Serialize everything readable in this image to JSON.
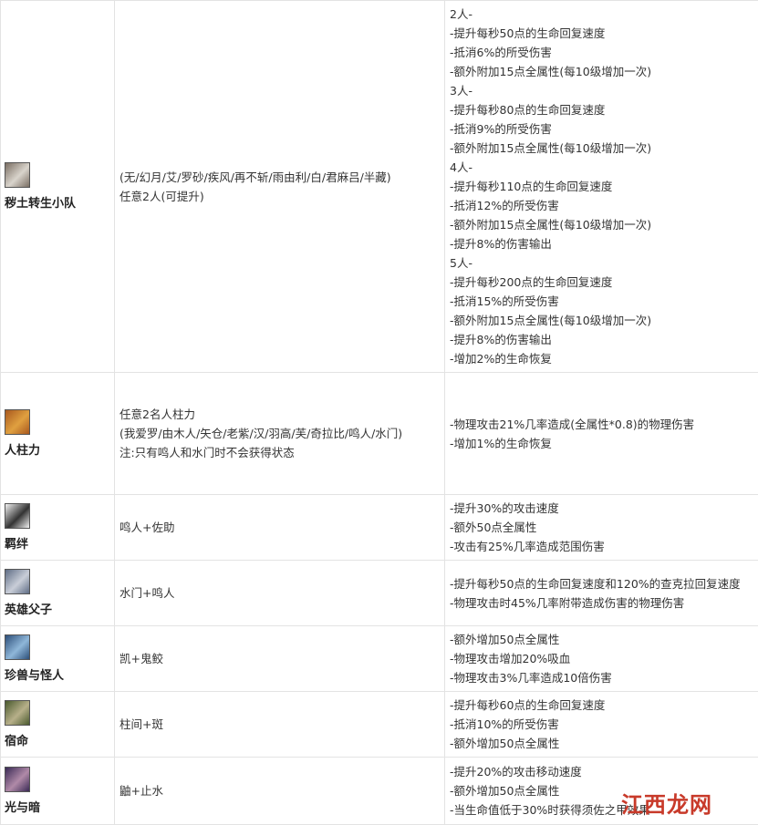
{
  "rows": [
    {
      "name": "秽土转生小队",
      "icon": "edo-tensei-team-icon",
      "icon_colors": [
        "#7a6e63",
        "#d9d4cc"
      ],
      "members": [
        "(无/幻月/艾/罗砂/疾风/再不斩/雨由利/白/君麻吕/半藏)",
        "任意2人(可提升)"
      ],
      "effects": [
        "2人-",
        "-提升每秒50点的生命回复速度",
        "-抵消6%的所受伤害",
        "-额外附加15点全属性(每10级增加一次)",
        "3人-",
        "-提升每秒80点的生命回复速度",
        "-抵消9%的所受伤害",
        "-额外附加15点全属性(每10级增加一次)",
        "4人-",
        "-提升每秒110点的生命回复速度",
        "-抵消12%的所受伤害",
        "-额外附加15点全属性(每10级增加一次)",
        "-提升8%的伤害输出",
        "5人-",
        "-提升每秒200点的生命回复速度",
        "-抵消15%的所受伤害",
        "-额外附加15点全属性(每10级增加一次)",
        "-提升8%的伤害输出",
        "-增加2%的生命恢复"
      ]
    },
    {
      "name": "人柱力",
      "icon": "jinchuriki-icon",
      "icon_colors": [
        "#a8581e",
        "#e0a040"
      ],
      "members": [
        "任意2名人柱力",
        "(我爱罗/由木人/矢仓/老紫/汉/羽高/芙/奇拉比/鸣人/水门)",
        "注:只有鸣人和水门时不会获得状态"
      ],
      "effects": [
        "-物理攻击21%几率造成(全属性*0.8)的物理伤害",
        "-增加1%的生命恢复"
      ]
    },
    {
      "name": "羁绊",
      "icon": "bond-icon",
      "icon_colors": [
        "#f2f2f2",
        "#333333"
      ],
      "members": [
        "鸣人+佐助"
      ],
      "effects": [
        "-提升30%的攻击速度",
        "-额外50点全属性",
        "-攻击有25%几率造成范围伤害"
      ]
    },
    {
      "name": "英雄父子",
      "icon": "hero-father-son-icon",
      "icon_colors": [
        "#5f6d85",
        "#c9ced8"
      ],
      "members": [
        "水门+鸣人"
      ],
      "effects": [
        "-提升每秒50点的生命回复速度和120%的查克拉回复速度",
        "-物理攻击时45%几率附带造成伤害的物理伤害"
      ]
    },
    {
      "name": "珍兽与怪人",
      "icon": "beast-and-freak-icon",
      "icon_colors": [
        "#2d4f7a",
        "#8fb7d9"
      ],
      "members": [
        "凯+鬼鲛"
      ],
      "effects": [
        "-额外增加50点全属性",
        "-物理攻击增加20%吸血",
        "-物理攻击3%几率造成10倍伤害"
      ]
    },
    {
      "name": "宿命",
      "icon": "destiny-icon",
      "icon_colors": [
        "#4a5a2e",
        "#b7b08a"
      ],
      "members": [
        "柱间+斑"
      ],
      "effects": [
        "-提升每秒60点的生命回复速度",
        "-抵消10%的所受伤害",
        "-额外增加50点全属性"
      ]
    },
    {
      "name": "光与暗",
      "icon": "light-and-dark-icon",
      "icon_colors": [
        "#3a2a55",
        "#b08aa8"
      ],
      "members": [
        "鼬+止水"
      ],
      "effects": [
        "-提升20%的攻击移动速度",
        "-额外增加50点全属性",
        "-当生命值低于30%时获得须佐之甲效果"
      ]
    }
  ],
  "watermark": {
    "text": "江西龙网",
    "color": "#c83a2a"
  }
}
